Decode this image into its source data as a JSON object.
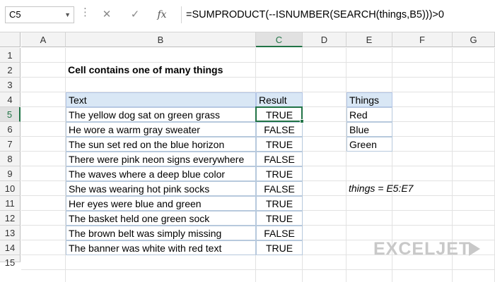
{
  "formula_bar": {
    "name_box": "C5",
    "cancel_glyph": "✕",
    "enter_glyph": "✓",
    "fx_label": "fx",
    "formula": "=SUMPRODUCT(--ISNUMBER(SEARCH(things,B5)))>0"
  },
  "columns": [
    "A",
    "B",
    "C",
    "D",
    "E",
    "F",
    "G"
  ],
  "rows": [
    "1",
    "2",
    "3",
    "4",
    "5",
    "6",
    "7",
    "8",
    "9",
    "10",
    "11",
    "12",
    "13",
    "14",
    "15"
  ],
  "selected_cell": "C5",
  "sheet": {
    "title": "Cell contains one of many things",
    "table": {
      "header_text": "Text",
      "header_result": "Result",
      "rows": [
        {
          "text": "The yellow dog sat on green grass",
          "result": "TRUE"
        },
        {
          "text": "He wore a warm gray sweater",
          "result": "FALSE"
        },
        {
          "text": "The sun set red on the blue horizon",
          "result": "TRUE"
        },
        {
          "text": "There were pink neon signs everywhere",
          "result": "FALSE"
        },
        {
          "text": "The waves where a deep blue color",
          "result": "TRUE"
        },
        {
          "text": "She was wearing hot pink socks",
          "result": "FALSE"
        },
        {
          "text": "Her eyes were blue and green",
          "result": "TRUE"
        },
        {
          "text": "The basket held one green sock",
          "result": "TRUE"
        },
        {
          "text": "The brown belt was simply missing",
          "result": "FALSE"
        },
        {
          "text": "The banner was white with red text",
          "result": "TRUE"
        }
      ]
    },
    "things": {
      "header": "Things",
      "items": [
        "Red",
        "Blue",
        "Green"
      ]
    },
    "named_range_note": "things = E5:E7"
  },
  "branding": {
    "logo_text": "EXCELJET"
  },
  "colors": {
    "accent": "#217346",
    "table_header_fill": "#d9e7f5"
  }
}
